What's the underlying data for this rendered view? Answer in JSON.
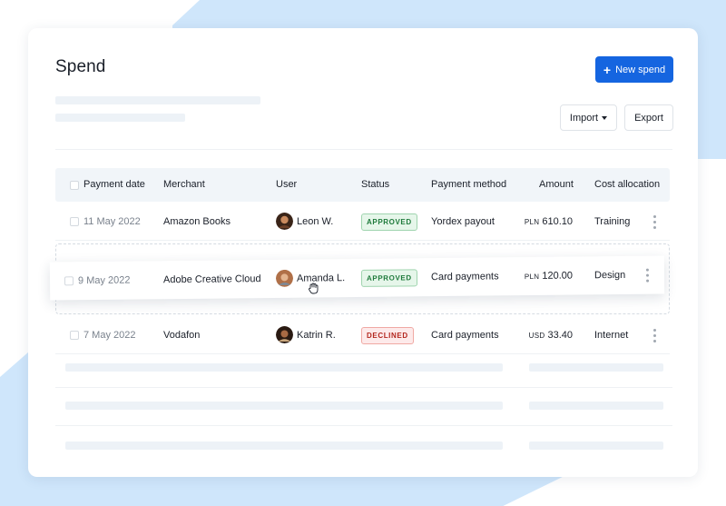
{
  "page": {
    "title": "Spend",
    "new_spend_label": "New spend",
    "import_label": "Import",
    "export_label": "Export"
  },
  "table": {
    "columns": [
      "Payment date",
      "Merchant",
      "User",
      "Status",
      "Payment method",
      "Amount",
      "Cost allocation"
    ],
    "rows": [
      {
        "date": "11 May 2022",
        "merchant": "Amazon Books",
        "user": "Leon W.",
        "status": "APPROVED",
        "method": "Yordex payout",
        "currency": "PLN",
        "amount": "610.10",
        "allocation": "Training"
      },
      {
        "date": "9 May 2022",
        "merchant": "Adobe Creative Cloud",
        "user": "Amanda L.",
        "status": "APPROVED",
        "method": "Card payments",
        "currency": "PLN",
        "amount": "120.00",
        "allocation": "Design"
      },
      {
        "date": "7 May 2022",
        "merchant": "Vodafon",
        "user": "Katrin R.",
        "status": "DECLINED",
        "method": "Card payments",
        "currency": "USD",
        "amount": "33.40",
        "allocation": "Internet"
      }
    ]
  },
  "colors": {
    "primary": "#1565e0",
    "background_shape": "#cfe6fb",
    "approved": "#1e7a3b",
    "declined": "#b3261e"
  },
  "icons": [
    "plus-icon",
    "caret-down-icon",
    "kebab-icon",
    "grab-hand-icon"
  ]
}
